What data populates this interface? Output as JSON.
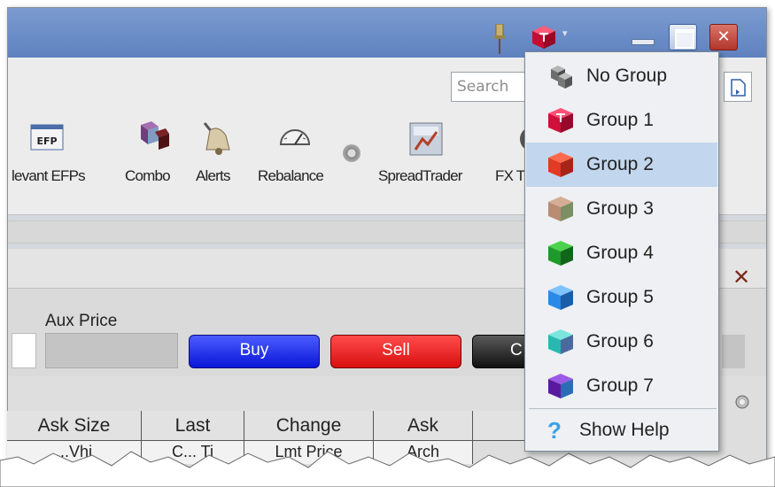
{
  "titlebar": {
    "icons": [
      "pin-icon",
      "group-cube-icon",
      "dropdown-arrow-icon",
      "minimize-icon",
      "maximize-icon",
      "close-icon"
    ],
    "dropdown_arrow": "▾",
    "close_glyph": "✕"
  },
  "search": {
    "placeholder": "Search"
  },
  "toolbar": {
    "tools": [
      {
        "label": "levant EFPs",
        "icon": "efp-icon",
        "icon_text": "EFP"
      },
      {
        "label": "Combo",
        "icon": "combo-cubes-icon"
      },
      {
        "label": "Alerts",
        "icon": "bell-icon"
      },
      {
        "label": "Rebalance",
        "icon": "gauge-icon"
      },
      {
        "label": "SpreadTrader",
        "icon": "spreadtrader-icon"
      },
      {
        "label": "FX T",
        "icon": "fx-icon"
      }
    ]
  },
  "order_entry": {
    "close_glyph": "✕",
    "aux_price_label": "Aux Price",
    "buy_label": "Buy",
    "sell_label": "Sell",
    "cancel_label": "C"
  },
  "table": {
    "headers": [
      "Ask Size",
      "Last",
      "Change",
      "Ask"
    ],
    "subheaders": [
      "...Vhi",
      "C... Ti",
      "Lmt Price",
      "Arch"
    ]
  },
  "group_menu": {
    "items": [
      {
        "label": "No Group",
        "icon": "no-group-icon",
        "color": "#7a7a7a",
        "selected": false
      },
      {
        "label": "Group 1",
        "icon": "group-1-cube-icon",
        "color": "#d0103a",
        "selected": false
      },
      {
        "label": "Group 2",
        "icon": "group-2-cube-icon",
        "color": "#e23a24",
        "selected": true
      },
      {
        "label": "Group 3",
        "icon": "group-3-cube-icon",
        "color": "#b88c72",
        "selected": false
      },
      {
        "label": "Group 4",
        "icon": "group-4-cube-icon",
        "color": "#1e9a2a",
        "selected": false
      },
      {
        "label": "Group 5",
        "icon": "group-5-cube-icon",
        "color": "#2a8ae6",
        "selected": false
      },
      {
        "label": "Group 6",
        "icon": "group-6-cube-icon",
        "color": "#28b8b0",
        "selected": false
      },
      {
        "label": "Group 7",
        "icon": "group-7-cube-icon",
        "color": "#5a1aa0",
        "selected": false
      }
    ],
    "help_label": "Show Help",
    "help_icon": "help-icon",
    "help_glyph": "?"
  },
  "colors": {
    "titlebar": "#6b8cc7",
    "menu_highlight": "#c2d6ee",
    "buy": "#0a16d8",
    "sell": "#d80f0f"
  }
}
